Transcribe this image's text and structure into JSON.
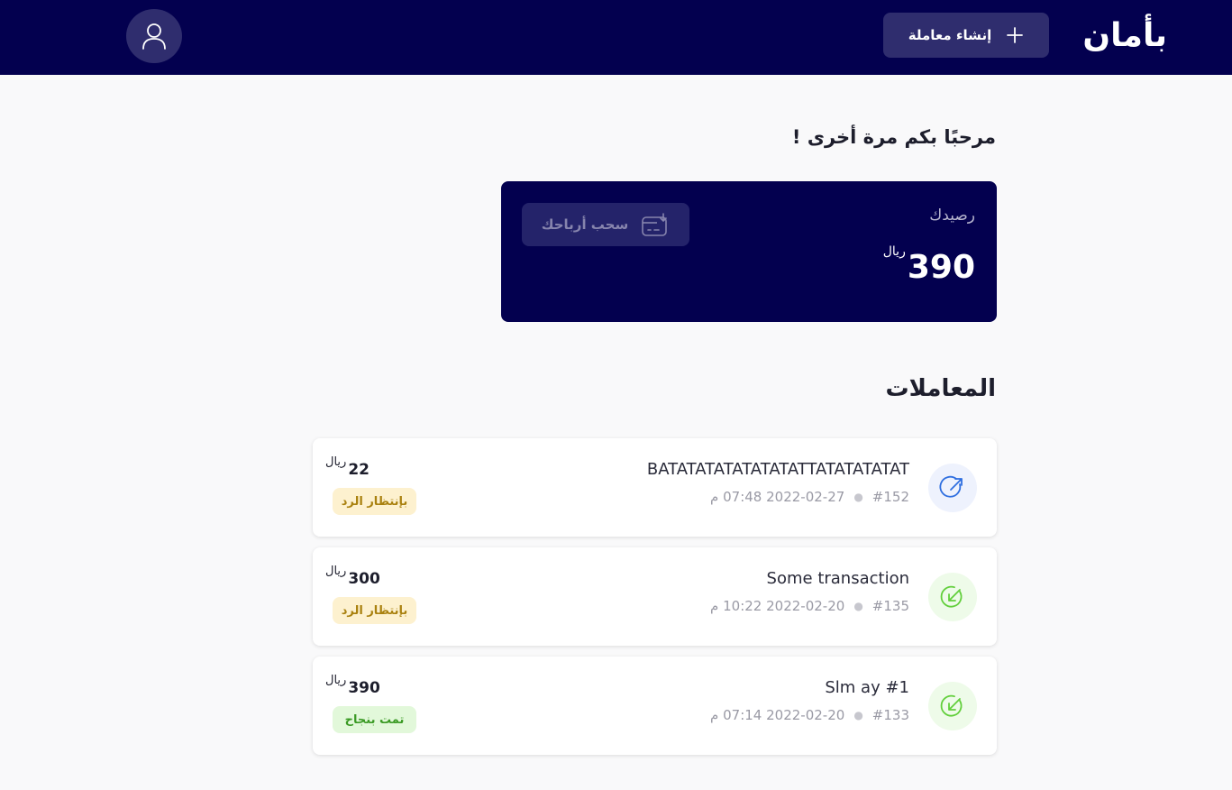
{
  "header": {
    "brand": "بأمان",
    "create_label": "إنشاء معاملة"
  },
  "greeting": "مرحبًا بكم مرة أخرى !",
  "balance": {
    "label": "رصيدك",
    "amount": "390",
    "currency": "ريال",
    "withdraw_label": "سحب أرباحك"
  },
  "transactions_title": "المعاملات",
  "transactions": [
    {
      "title": "BATATATATATATATATTATATATATAT",
      "id": "#152",
      "datetime": "2022-02-27 07:48 م",
      "amount": "22",
      "currency": "ريال",
      "status": "بإنتظار الرد",
      "status_type": "pending",
      "direction": "out"
    },
    {
      "title": "Some transaction",
      "id": "#135",
      "datetime": "2022-02-20 10:22 م",
      "amount": "300",
      "currency": "ريال",
      "status": "بإنتظار الرد",
      "status_type": "pending",
      "direction": "in"
    },
    {
      "title": "Slm ay #1",
      "id": "#133",
      "datetime": "2022-02-20 07:14 م",
      "amount": "390",
      "currency": "ريال",
      "status": "تمت بنجاح",
      "status_type": "success",
      "direction": "in"
    }
  ],
  "colors": {
    "navy": "#03004f",
    "pending": "#a9810f",
    "success": "#3a9a24",
    "outgoing_icon": "#2f6fe0",
    "incoming_icon": "#62cf3c"
  },
  "icons": {
    "create": "plus-icon",
    "avatar": "user-icon",
    "withdraw": "card-download-icon",
    "outgoing": "arrow-up-right-circle-icon",
    "incoming": "arrow-down-left-circle-icon"
  }
}
